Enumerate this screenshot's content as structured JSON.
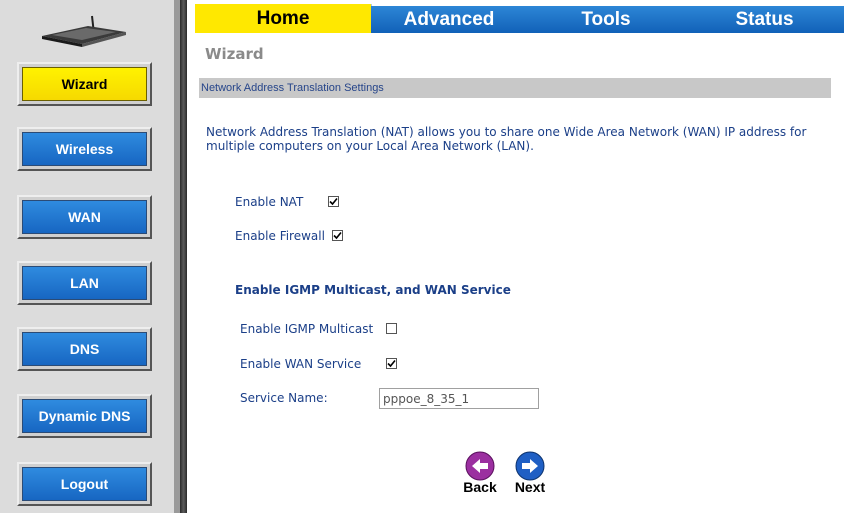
{
  "colors": {
    "active": "#ffe800",
    "tab_blue": "#1766c2",
    "sidebar_bg": "#dcdcdc",
    "text_blue": "#1b3f88",
    "section_bar": "#c8c8c8",
    "back_purple": "#9b2fa0",
    "next_blue": "#1f5fc4"
  },
  "sidebar": {
    "logo_icon": "router-icon",
    "items": [
      {
        "label": "Wizard",
        "active": true
      },
      {
        "label": "Wireless"
      },
      {
        "label": "WAN"
      },
      {
        "label": "LAN"
      },
      {
        "label": "DNS"
      },
      {
        "label": "Dynamic DNS"
      },
      {
        "label": "Logout"
      }
    ]
  },
  "tabs": [
    {
      "label": "Home",
      "active": true
    },
    {
      "label": "Advanced"
    },
    {
      "label": "Tools"
    },
    {
      "label": "Status"
    }
  ],
  "main": {
    "title": "Wizard",
    "section_header": "Network Address Translation Settings",
    "description": "Network Address Translation (NAT) allows you to share one Wide Area Network (WAN) IP address for multiple computers on your Local Area Network (LAN).",
    "enable_nat": {
      "label": "Enable NAT",
      "checked": true
    },
    "enable_firewall": {
      "label": "Enable Firewall",
      "checked": true
    },
    "subsection_title": "Enable IGMP Multicast, and WAN Service",
    "enable_igmp": {
      "label": "Enable IGMP Multicast",
      "checked": false
    },
    "enable_wan_service": {
      "label": "Enable WAN Service",
      "checked": true
    },
    "service_name": {
      "label": "Service Name:",
      "value": "pppoe_8_35_1"
    },
    "back_label": "Back",
    "next_label": "Next"
  }
}
